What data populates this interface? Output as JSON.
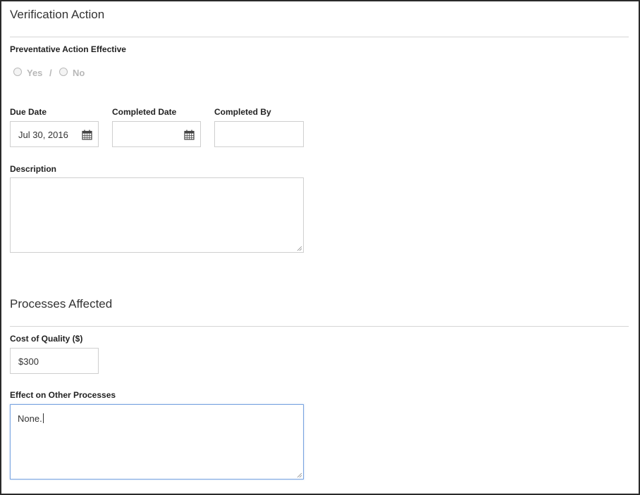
{
  "verification": {
    "title": "Verification Action",
    "effective_label": "Preventative Action Effective",
    "yes_label": "Yes",
    "separator": "/",
    "no_label": "No",
    "due_date_label": "Due Date",
    "due_date_value": "Jul 30, 2016",
    "completed_date_label": "Completed Date",
    "completed_date_value": "",
    "completed_by_label": "Completed By",
    "completed_by_value": "",
    "description_label": "Description",
    "description_value": ""
  },
  "processes": {
    "title": "Processes Affected",
    "cost_label": "Cost of Quality ($)",
    "cost_value": "$300",
    "effect_label": "Effect on Other Processes",
    "effect_value": "None."
  },
  "icons": {
    "calendar": "calendar-icon",
    "resize": "resize-grip-icon"
  },
  "colors": {
    "focus_border": "#7ba5e0",
    "input_border": "#cfcfcf",
    "muted_text": "#b8b8b8"
  }
}
